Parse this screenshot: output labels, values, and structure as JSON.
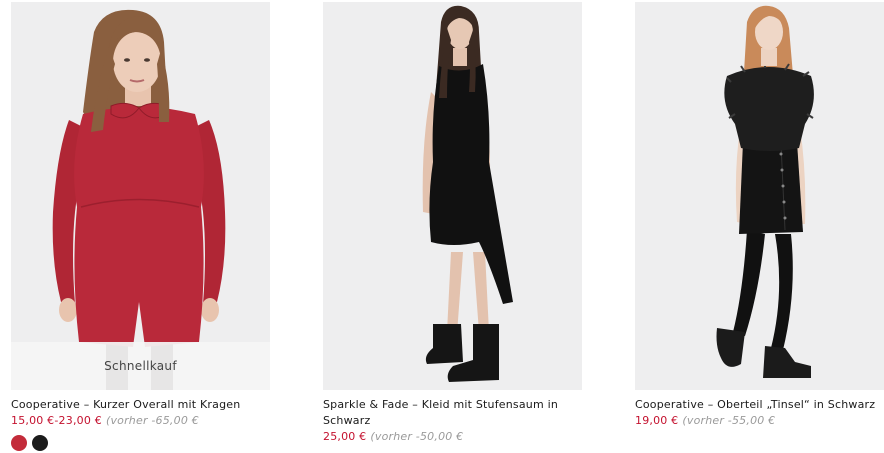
{
  "products": [
    {
      "title": "Cooperative – Kurzer Overall mit Kragen",
      "price": "15,00 €-23,00 €",
      "was_price": "(vorher -65,00 €",
      "quickbuy_label": "Schnellkauf",
      "swatch_colors": [
        "#c32b3a",
        "#1c1c1c"
      ]
    },
    {
      "title": "Sparkle & Fade – Kleid mit Stufensaum in Schwarz",
      "price": "25,00 €",
      "was_price": "(vorher -50,00 €"
    },
    {
      "title": "Cooperative – Oberteil „Tinsel“ in Schwarz",
      "price": "19,00 €",
      "was_price": "(vorher -55,00 €"
    }
  ],
  "colors": {
    "sale_price": "#c4122f",
    "was_price": "#9a9a9a",
    "image_background": "#eeeeef"
  }
}
